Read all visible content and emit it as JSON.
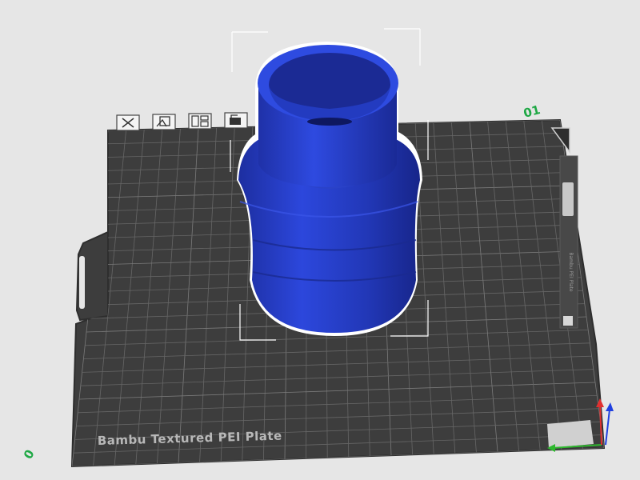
{
  "plate": {
    "name": "Bambu Textured PEI Plate",
    "index": "01",
    "corner_mark": "0",
    "side_label": "Bambu PEI Plate"
  },
  "plate_toolbar": {
    "buttons": [
      {
        "name": "delete-plate-button",
        "icon": "close-icon"
      },
      {
        "name": "orient-plate-button",
        "icon": "orient-icon"
      },
      {
        "name": "arrange-plate-button",
        "icon": "arrange-icon"
      },
      {
        "name": "lock-plate-button",
        "icon": "lock-icon"
      }
    ]
  },
  "colors": {
    "background": "#e6e6e6",
    "plate": "#3d3d3d",
    "grid": "#686868",
    "model": "#2b44d4",
    "model_dark": "#1f33a8",
    "selection": "#ffffff",
    "axis_x": "#2eb82e",
    "axis_y": "#e03030",
    "axis_z": "#2040e0",
    "plate_index": "#1fa845"
  }
}
